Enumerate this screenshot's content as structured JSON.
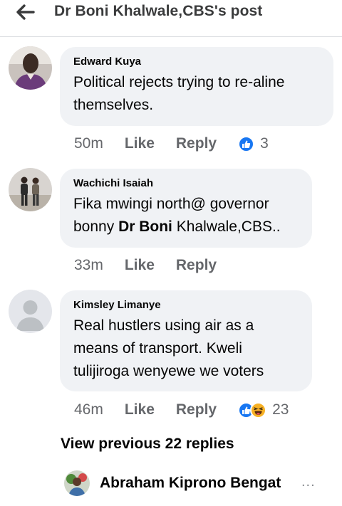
{
  "header": {
    "back_icon": "arrow-left-icon",
    "title": "Dr Boni Khalwale,CBS's post"
  },
  "comments": [
    {
      "author": "Edward Kuya",
      "lines": [
        "Political rejects trying to re-aline",
        "themselves."
      ],
      "time": "50m",
      "like_label": "Like",
      "reply_label": "Reply",
      "reactions": [
        "like-reaction-icon"
      ],
      "reaction_count": "3"
    },
    {
      "author": "Wachichi Isaiah",
      "lines": [
        "Fika mwingi north@ governor"
      ],
      "line2_prefix": "bonny ",
      "line2_bold": "Dr Boni",
      "line2_suffix": " Khalwale,CBS..",
      "time": "33m",
      "like_label": "Like",
      "reply_label": "Reply"
    },
    {
      "author": "Kimsley Limanye",
      "lines": [
        "Real hustlers using air as a",
        "means of transport. Kweli",
        "tulijiroga wenyewe we voters"
      ],
      "time": "46m",
      "like_label": "Like",
      "reply_label": "Reply",
      "reactions": [
        "like-reaction-icon",
        "haha-reaction-icon"
      ],
      "reaction_count": "23"
    }
  ],
  "view_previous": "View previous 22 replies",
  "reply_preview": {
    "author": "Abraham Kiprono Bengat",
    "more": "..."
  },
  "colors": {
    "bubble": "#f0f2f5",
    "secondary_text": "#65676b",
    "like_blue": "#1877f2",
    "haha_yellow": "#f7b125"
  }
}
